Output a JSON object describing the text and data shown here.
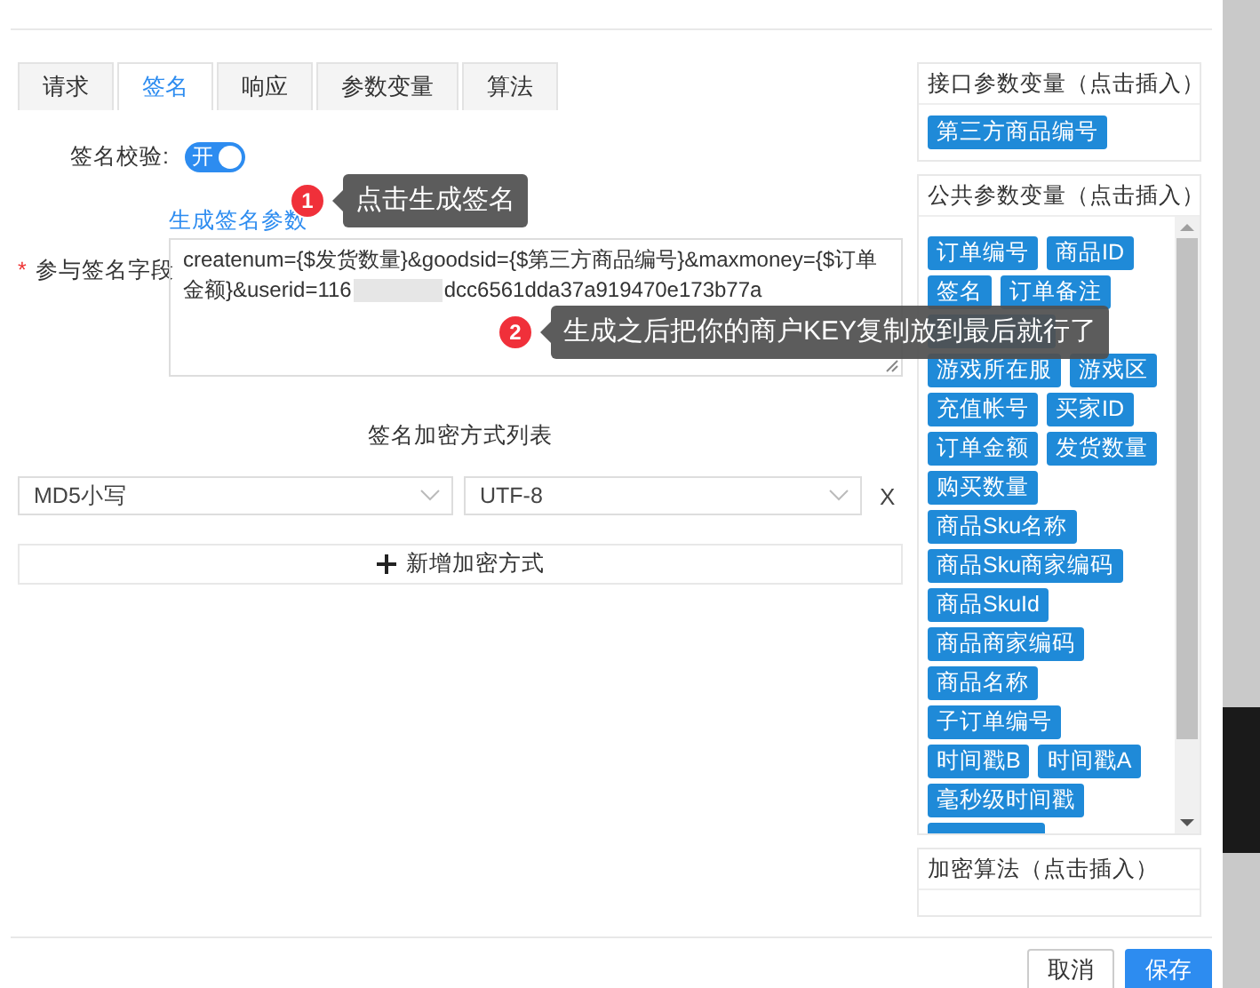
{
  "tabs": [
    {
      "label": "请求",
      "selected": false
    },
    {
      "label": "签名",
      "selected": true
    },
    {
      "label": "响应",
      "selected": false
    },
    {
      "label": "参数变量",
      "selected": false
    },
    {
      "label": "算法",
      "selected": false
    }
  ],
  "sign_check": {
    "label": "签名校验:",
    "toggle_text": "开",
    "on": true
  },
  "generate_link": "生成签名参数",
  "sign_fields": {
    "label": "参与签名字段",
    "required_mark": "*",
    "value_start": "createnum={$发货数量}&goodsid={$第三方商品编号}&maxmoney={$订单金额}&userid=116",
    "value_end": "dcc6561dda37a919470e173b77a"
  },
  "encrypt_list": {
    "title": "签名加密方式列表",
    "rows": [
      {
        "algorithm": "MD5小写",
        "charset": "UTF-8",
        "remove": "X"
      }
    ],
    "add_button": "新增加密方式"
  },
  "panels": [
    {
      "title": "接口参数变量（点击插入）",
      "scroll": false,
      "rows": [
        [
          {
            "kind": "label",
            "text": "第三方商品编号"
          }
        ]
      ]
    },
    {
      "title": "公共参数变量（点击插入）",
      "scroll": true,
      "rows": [
        [
          {
            "kind": "label",
            "text": "订单编号"
          },
          {
            "kind": "label",
            "text": "商品ID"
          }
        ],
        [
          {
            "kind": "label",
            "text": "签名"
          },
          {
            "kind": "label",
            "text": "订单备注"
          }
        ],
        [
          {
            "kind": "covered"
          }
        ],
        [
          {
            "kind": "label",
            "text": "游戏所在服"
          },
          {
            "kind": "label",
            "text": "游戏区"
          }
        ],
        [
          {
            "kind": "label",
            "text": "充值帐号"
          },
          {
            "kind": "label",
            "text": "买家ID"
          }
        ],
        [
          {
            "kind": "label",
            "text": "订单金额"
          },
          {
            "kind": "label",
            "text": "发货数量"
          }
        ],
        [
          {
            "kind": "label",
            "text": "购买数量"
          }
        ],
        [
          {
            "kind": "label",
            "text": "商品Sku名称"
          }
        ],
        [
          {
            "kind": "label",
            "text": "商品Sku商家编码"
          }
        ],
        [
          {
            "kind": "label",
            "text": "商品SkuId"
          }
        ],
        [
          {
            "kind": "label",
            "text": "商品商家编码"
          }
        ],
        [
          {
            "kind": "label",
            "text": "商品名称"
          }
        ],
        [
          {
            "kind": "label",
            "text": "子订单编号"
          }
        ],
        [
          {
            "kind": "label",
            "text": "时间戳B"
          },
          {
            "kind": "label",
            "text": "时间戳A"
          }
        ],
        [
          {
            "kind": "label",
            "text": "毫秒级时间戳"
          }
        ],
        [
          {
            "kind": "cut"
          }
        ]
      ]
    },
    {
      "title": "加密算法（点击插入）",
      "scroll": false
    }
  ],
  "tooltips": [
    {
      "number": "1",
      "text": "点击生成签名"
    },
    {
      "number": "2",
      "text": "生成之后把你的商户KEY复制放到最后就行了"
    }
  ],
  "footer_buttons": [
    {
      "label": "取消",
      "kind": "default"
    },
    {
      "label": "保存",
      "kind": "primary"
    }
  ]
}
